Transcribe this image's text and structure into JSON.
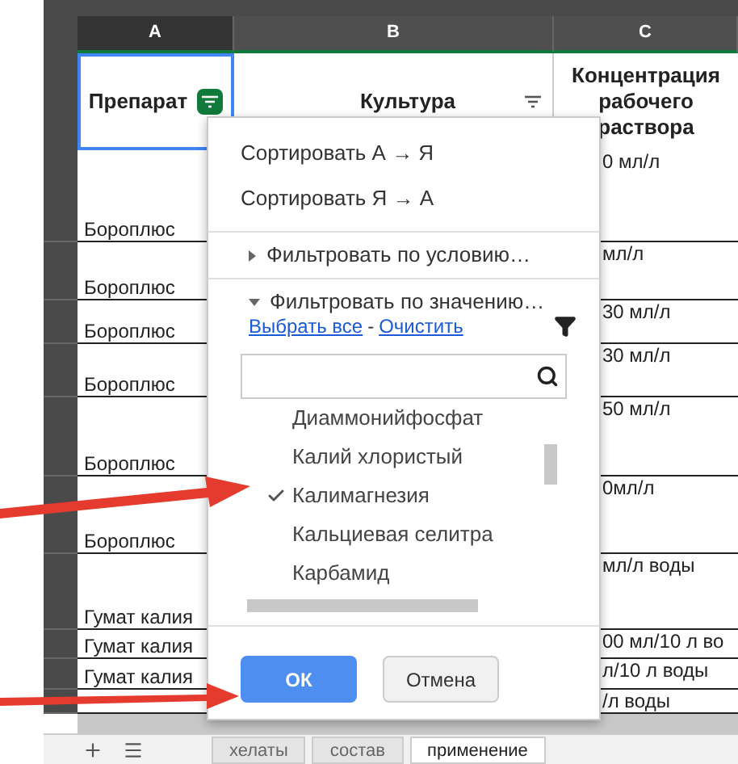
{
  "columns": [
    {
      "letter": "A",
      "selected": true
    },
    {
      "letter": "B",
      "selected": false
    },
    {
      "letter": "C",
      "selected": false
    }
  ],
  "header_row": {
    "preparation": {
      "text": "Препарат",
      "filter_active": true
    },
    "culture": {
      "text": "Культура",
      "filter_active": false
    },
    "concentration": {
      "text": "Концентрация рабочего раствора"
    }
  },
  "rows": [
    {
      "preparation": "Бороплюс",
      "concentration": "0 мл/л"
    },
    {
      "preparation": "Бороплюс",
      "concentration": "мл/л"
    },
    {
      "preparation": "Бороплюс",
      "concentration": "30 мл/л"
    },
    {
      "preparation": "Бороплюс",
      "concentration": "30 мл/л"
    },
    {
      "preparation": "Бороплюс",
      "concentration": "50 мл/л"
    },
    {
      "preparation": "Бороплюс",
      "concentration": "0мл/л"
    },
    {
      "preparation": "Гумат калия",
      "concentration": "мл/л воды"
    },
    {
      "preparation": "Гумат калия",
      "concentration": "00 мл/10 л во"
    },
    {
      "preparation": "Гумат калия",
      "concentration": "л/10 л воды"
    },
    {
      "concentration": "/л воды"
    }
  ],
  "filter_menu": {
    "sort_items": [
      "Сортировать А → Я",
      "Сортировать Я → А"
    ],
    "sections": [
      {
        "label": "Фильтровать по условию…",
        "expanded": false
      },
      {
        "label": "Фильтровать по значению…",
        "expanded": true
      }
    ],
    "select_all": "Выбрать все",
    "separator": "-",
    "clear": "Очистить",
    "values": [
      {
        "label": "Диаммонийфосфат",
        "checked": false
      },
      {
        "label": "Калий хлористый",
        "checked": false
      },
      {
        "label": "Калимагнезия",
        "checked": true
      },
      {
        "label": "Кальциевая селитра",
        "checked": false
      },
      {
        "label": "Карбамид",
        "checked": false
      }
    ],
    "buttons": [
      {
        "label": "ОК",
        "kind": "primary"
      },
      {
        "label": "Отмена",
        "kind": "secondary"
      }
    ]
  },
  "sheet_tabs": [
    {
      "label": "хелаты",
      "selected": false
    },
    {
      "label": "состав",
      "selected": false
    },
    {
      "label": "применение",
      "selected": true
    }
  ]
}
